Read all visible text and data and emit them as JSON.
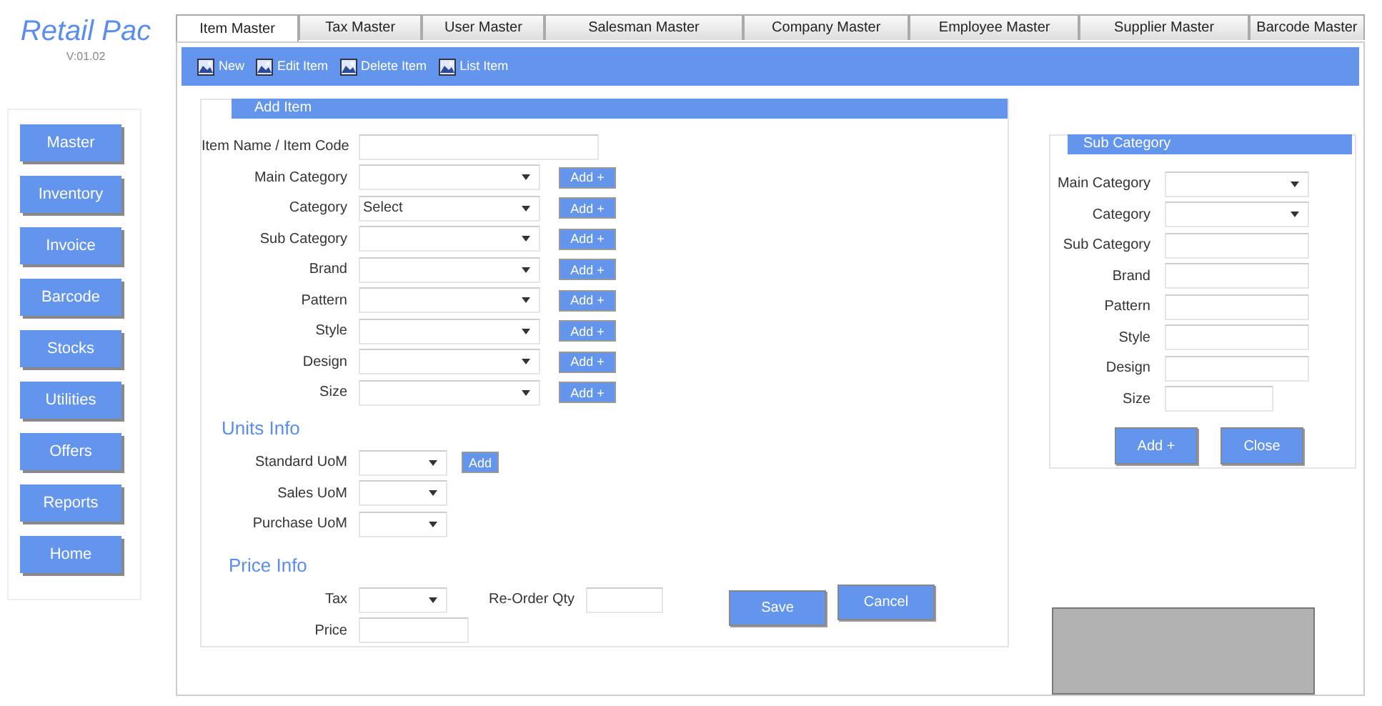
{
  "app": {
    "title": "Retail Pac",
    "version": "V:01.02"
  },
  "nav": [
    {
      "label": "Master"
    },
    {
      "label": "Inventory"
    },
    {
      "label": "Invoice"
    },
    {
      "label": "Barcode"
    },
    {
      "label": "Stocks"
    },
    {
      "label": "Utilities"
    },
    {
      "label": "Offers"
    },
    {
      "label": "Reports"
    },
    {
      "label": "Home"
    }
  ],
  "tabs": [
    {
      "label": "Item Master",
      "selected": true
    },
    {
      "label": "Tax Master",
      "selected": false
    },
    {
      "label": "User Master",
      "selected": false
    },
    {
      "label": "Salesman Master",
      "selected": false
    },
    {
      "label": "Company Master",
      "selected": false
    },
    {
      "label": "Employee Master",
      "selected": false
    },
    {
      "label": "Supplier Master",
      "selected": false
    },
    {
      "label": "Barcode Master",
      "selected": false
    }
  ],
  "toolbar": [
    {
      "label": "New"
    },
    {
      "label": "Edit Item"
    },
    {
      "label": "Delete Item"
    },
    {
      "label": "List Item"
    }
  ],
  "add_item": {
    "title": "Add Item",
    "fields": [
      {
        "label": "Item Name / Item Code",
        "kind": "text"
      },
      {
        "label": "Main Category",
        "kind": "select",
        "add": "Add +"
      },
      {
        "label": "Category",
        "kind": "select",
        "value": "Select",
        "add": "Add +"
      },
      {
        "label": "Sub Category",
        "kind": "select",
        "add": "Add +"
      },
      {
        "label": "Brand",
        "kind": "select",
        "add": "Add +"
      },
      {
        "label": "Pattern",
        "kind": "select",
        "add": "Add +"
      },
      {
        "label": "Style",
        "kind": "select",
        "add": "Add +"
      },
      {
        "label": "Design",
        "kind": "select",
        "add": "Add +"
      },
      {
        "label": "Size",
        "kind": "select",
        "add": "Add +"
      }
    ],
    "units_title": "Units Info",
    "units": [
      {
        "label": "Standard UoM",
        "kind": "select",
        "add": "Add"
      },
      {
        "label": "Sales UoM",
        "kind": "select"
      },
      {
        "label": "Purchase UoM",
        "kind": "select"
      }
    ],
    "price_title": "Price Info",
    "price_rows": [
      [
        {
          "label": "Tax",
          "kind": "select"
        },
        {
          "label": "Re-Order Qty",
          "kind": "text"
        }
      ],
      [
        {
          "label": "Price",
          "kind": "text"
        }
      ]
    ],
    "buttons": [
      "Save",
      "Cancel"
    ]
  },
  "sub_category": {
    "title": "Sub Category",
    "fields": [
      {
        "label": "Main Category",
        "kind": "select"
      },
      {
        "label": "Category",
        "kind": "select"
      },
      {
        "label": "Sub Category",
        "kind": "text"
      },
      {
        "label": "Brand",
        "kind": "text"
      },
      {
        "label": "Pattern",
        "kind": "text"
      },
      {
        "label": "Style",
        "kind": "text"
      },
      {
        "label": "Design",
        "kind": "text"
      },
      {
        "label": "Size",
        "kind": "short"
      }
    ],
    "buttons": [
      "Add +",
      "Close"
    ]
  }
}
